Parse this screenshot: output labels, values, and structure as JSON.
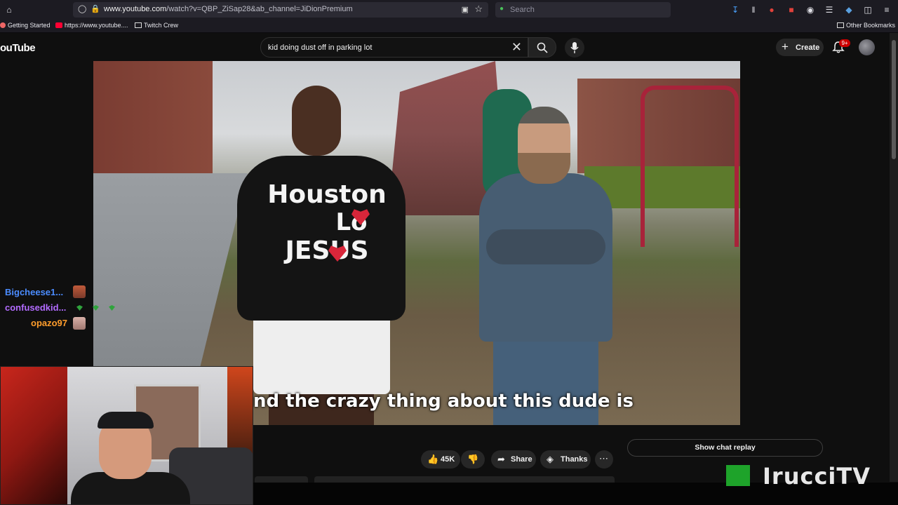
{
  "browser": {
    "url_prefix": "www.youtube.com",
    "url_rest": "/watch?v=QBP_ZiSap28&ab_channel=JiDionPremium",
    "search_placeholder": "Search",
    "bookmarks": [
      "Getting Started",
      "https://www.youtube....",
      "Twitch Crew"
    ],
    "other_bookmarks": "Other Bookmarks"
  },
  "youtube": {
    "logo": "ouTube",
    "search_query": "kid doing dust off in parking lot",
    "create_label": "Create",
    "notification_count": "9+"
  },
  "video": {
    "shirt_line1": "Houston",
    "shirt_line2": "Lo",
    "shirt_line3": "JESUS",
    "caption": "nd the crazy thing about this dude is"
  },
  "chat": [
    {
      "user": "Bigcheese1...",
      "color": "#4b8cff"
    },
    {
      "user": "confusedkid...",
      "color": "#b26bff"
    },
    {
      "user": "opazo97",
      "color": "#ff9d2c"
    }
  ],
  "actions": {
    "likes": "45K",
    "share": "Share",
    "thanks": "Thanks",
    "show_chat_replay": "Show chat replay"
  },
  "overlay": {
    "watermark": "IrucciTV"
  }
}
